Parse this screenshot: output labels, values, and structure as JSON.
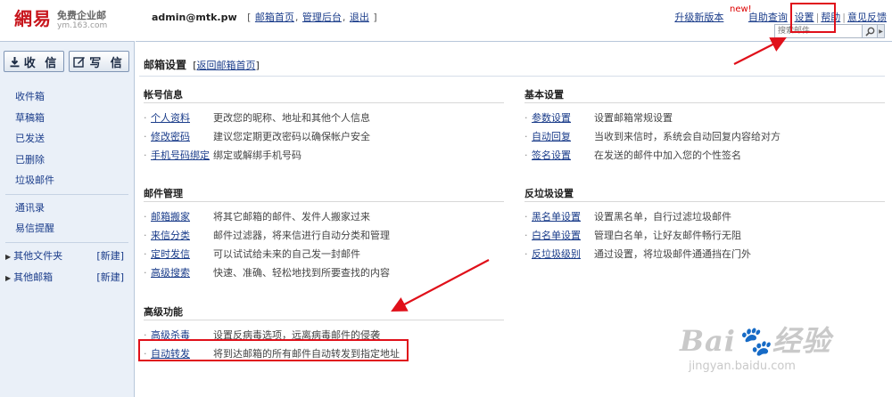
{
  "logo": {
    "main": "網易",
    "product": "免费企业邮",
    "domain": "ym.163.com"
  },
  "account": {
    "email": "admin@mtk.pw",
    "link_home": "邮箱首页",
    "link_admin": "管理后台",
    "link_logout": "退出"
  },
  "toplinks": {
    "upgrade": "升级新版本",
    "new_badge": "new!",
    "self_help": "自助查询",
    "settings": "设置",
    "help": "帮助",
    "feedback": "意见反馈"
  },
  "search": {
    "placeholder": "搜索邮件"
  },
  "sidebar": {
    "receive_label": "收 信",
    "compose_label": "写 信",
    "folders": [
      "收件箱",
      "草稿箱",
      "已发送",
      "已删除",
      "垃圾邮件"
    ],
    "tools": [
      "通讯录",
      "易信提醒"
    ],
    "groups": [
      {
        "label": "其他文件夹",
        "action": "[新建]"
      },
      {
        "label": "其他邮箱",
        "action": "[新建]"
      }
    ]
  },
  "main": {
    "title": "邮箱设置",
    "back_link": "返回邮箱首页",
    "sections": {
      "account": {
        "heading": "帐号信息",
        "rows": [
          {
            "link": "个人资料",
            "desc": "更改您的昵称、地址和其他个人信息"
          },
          {
            "link": "修改密码",
            "desc": "建议您定期更改密码以确保帐户安全"
          },
          {
            "link": "手机号码绑定",
            "desc": "绑定或解绑手机号码"
          }
        ]
      },
      "basic": {
        "heading": "基本设置",
        "rows": [
          {
            "link": "参数设置",
            "desc": "设置邮箱常规设置"
          },
          {
            "link": "自动回复",
            "desc": "当收到来信时，系统会自动回复内容给对方"
          },
          {
            "link": "签名设置",
            "desc": "在发送的邮件中加入您的个性签名"
          }
        ]
      },
      "mail": {
        "heading": "邮件管理",
        "rows": [
          {
            "link": "邮箱搬家",
            "desc": "将其它邮箱的邮件、发件人搬家过来"
          },
          {
            "link": "来信分类",
            "desc": "邮件过滤器，将来信进行自动分类和管理"
          },
          {
            "link": "定时发信",
            "desc": "可以试试给未来的自己发一封邮件"
          },
          {
            "link": "高级搜索",
            "desc": "快速、准确、轻松地找到所要查找的内容"
          }
        ]
      },
      "spam": {
        "heading": "反垃圾设置",
        "rows": [
          {
            "link": "黑名单设置",
            "desc": "设置黑名单，自行过滤垃圾邮件"
          },
          {
            "link": "白名单设置",
            "desc": "管理白名单，让好友邮件畅行无阻"
          },
          {
            "link": "反垃圾级别",
            "desc": "通过设置，将垃圾邮件通通挡在门外"
          }
        ]
      },
      "advanced": {
        "heading": "高级功能",
        "rows": [
          {
            "link": "高级杀毒",
            "desc": "设置反病毒选项，远离病毒邮件的侵袭"
          },
          {
            "link": "自动转发",
            "desc": "将到达邮箱的所有邮件自动转发到指定地址"
          }
        ]
      }
    }
  },
  "watermark": {
    "main": "Bai🐾经验",
    "sub": "jingyan.baidu.com"
  },
  "colors": {
    "annotation_red": "#e0101a",
    "link_blue": "#1a3c8a",
    "sidebar_bg": "#eaf0f8"
  }
}
